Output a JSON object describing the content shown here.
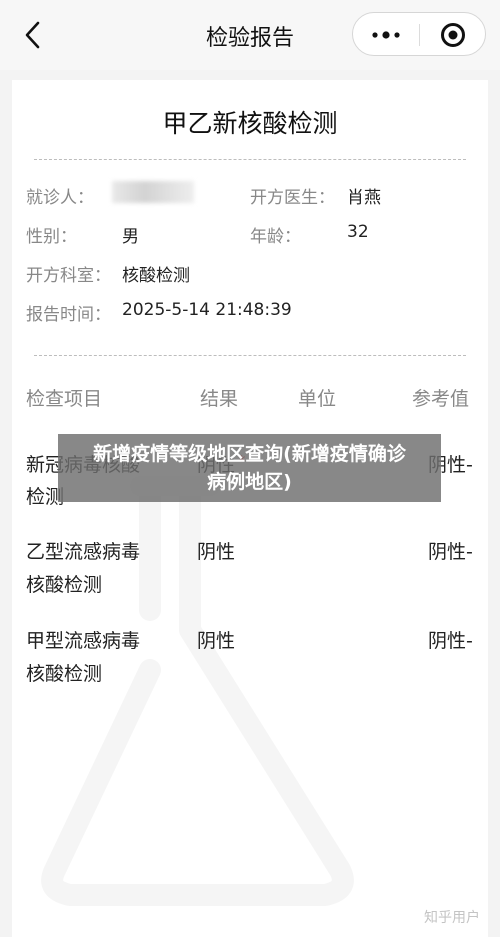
{
  "navbar": {
    "title": "检验报告",
    "back_icon": "chevron-left-icon",
    "more_icon": "more-dots-icon",
    "close_icon": "target-close-icon"
  },
  "report": {
    "title": "甲乙新核酸检测",
    "patient_label": "就诊人：",
    "doctor_label": "开方医生：",
    "doctor_value": "肖燕",
    "gender_label": "性别：",
    "gender_value": "男",
    "age_label": "年龄：",
    "age_value": "32",
    "dept_label": "开方科室：",
    "dept_value": "核酸检测",
    "time_label": "报告时间：",
    "time_value": "2025-5-14 21:48:39"
  },
  "table": {
    "headers": [
      "检查项目",
      "结果",
      "单位",
      "参考值"
    ],
    "rows": [
      {
        "item_line1": "新冠病毒核酸",
        "item_line2": "检测",
        "result": "阴性",
        "flag": "*",
        "reference": "阴性-"
      },
      {
        "item_line1": "乙型流感病毒",
        "item_line2": "核酸检测",
        "result": "阴性",
        "reference": "阴性-"
      },
      {
        "item_line1": "甲型流感病毒",
        "item_line2": "核酸检测",
        "result": "阴性",
        "reference": "阴性-"
      }
    ]
  },
  "overlay": {
    "line1": "新增疫情等级地区查询(新增疫情确诊",
    "line2": "病例地区)"
  },
  "watermark": "知乎用户",
  "colors": {
    "label_gray": "#888888",
    "flag_red": "#ee3333",
    "overlay_bg": "#6e6e6e"
  }
}
